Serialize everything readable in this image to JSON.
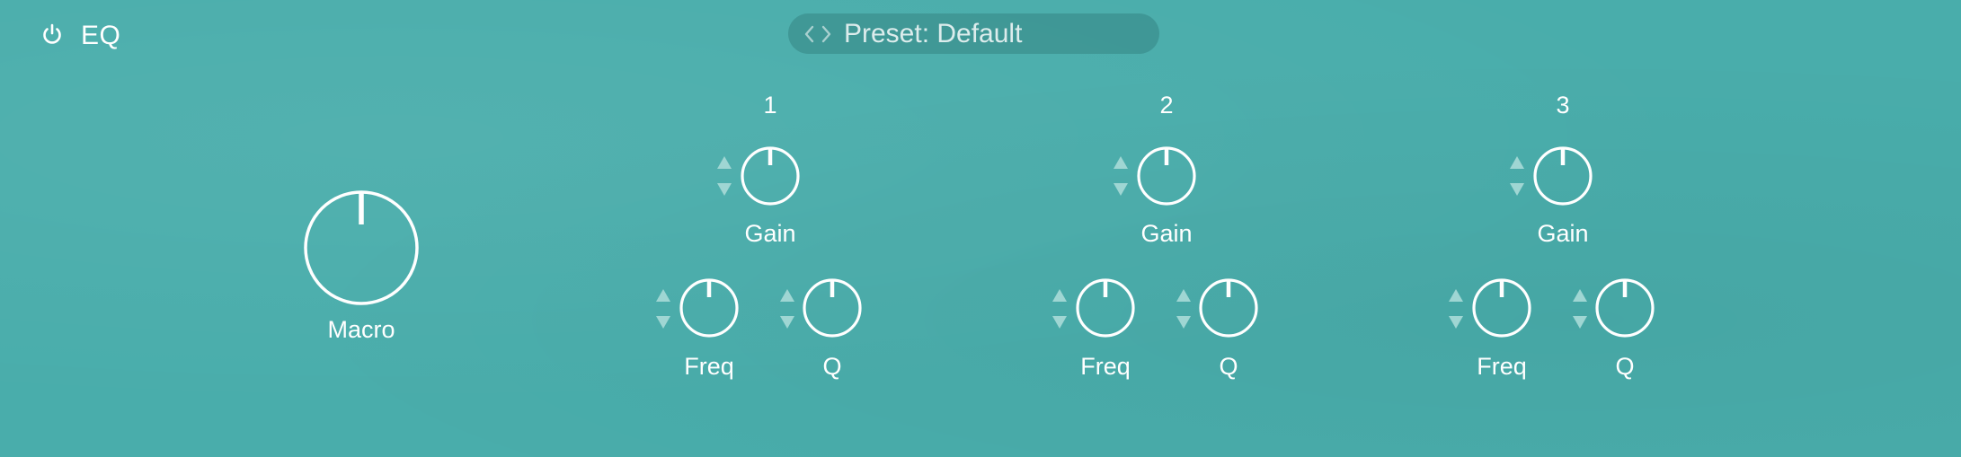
{
  "header": {
    "title": "EQ",
    "power_icon": "power-icon",
    "preset_label": "Preset: Default",
    "preset_nav_icon": "chevron-left-right-icon"
  },
  "macro": {
    "label": "Macro",
    "value": 0.5
  },
  "bands": [
    {
      "number": "1",
      "gain": {
        "label": "Gain",
        "value": 0.5
      },
      "freq": {
        "label": "Freq",
        "value": 0.5
      },
      "q": {
        "label": "Q",
        "value": 0.5
      }
    },
    {
      "number": "2",
      "gain": {
        "label": "Gain",
        "value": 0.5
      },
      "freq": {
        "label": "Freq",
        "value": 0.5
      },
      "q": {
        "label": "Q",
        "value": 0.5
      }
    },
    {
      "number": "3",
      "gain": {
        "label": "Gain",
        "value": 0.5
      },
      "freq": {
        "label": "Freq",
        "value": 0.5
      },
      "q": {
        "label": "Q",
        "value": 0.5
      }
    }
  ],
  "colors": {
    "background": "#49adab",
    "foreground": "#ffffff",
    "stepper": "#9fd6d3",
    "preset_pill": "#3f9795"
  }
}
